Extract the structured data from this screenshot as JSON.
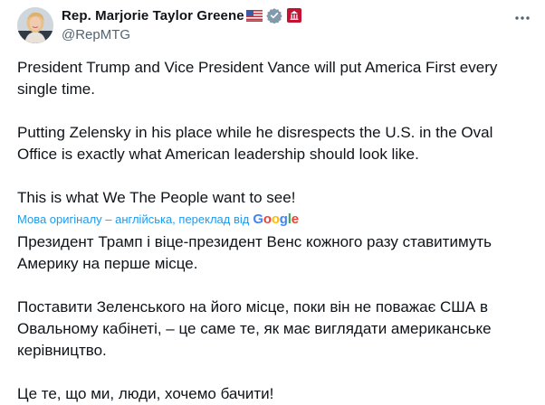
{
  "author": {
    "display_name": "Rep. Marjorie Taylor Greene",
    "handle": "@RepMTG",
    "flag_icon": "us-flag-icon",
    "verified_icon": "verified-badge-icon",
    "affiliation_icon": "government-affiliation-icon"
  },
  "menu": {
    "icon": "more-horizontal-icon"
  },
  "post": {
    "original": [
      "President Trump and Vice President Vance will put America First every single time.",
      "Putting Zelensky in his place while he disrespects the U.S. in the Oval Office is exactly what American leadership should look like.",
      "This is what We The People want to see!"
    ],
    "translation_note": "Мова оригіналу – англійська, переклад від",
    "translation_provider": "Google",
    "translated": [
      "Президент Трамп і віце-президент Венс кожного разу ставитимуть Америку на перше місце.",
      "Поставити Зеленського на його місце, поки він не поважає США в Овальному кабінеті, – це саме те, як має виглядати американське керівництво.",
      "Це те, що ми, люди, хочемо бачити!"
    ]
  },
  "colors": {
    "text": "#0f1419",
    "secondary": "#536471",
    "link": "#1d9bf0",
    "verified": "#829aab",
    "gov_badge": "#c41230"
  }
}
